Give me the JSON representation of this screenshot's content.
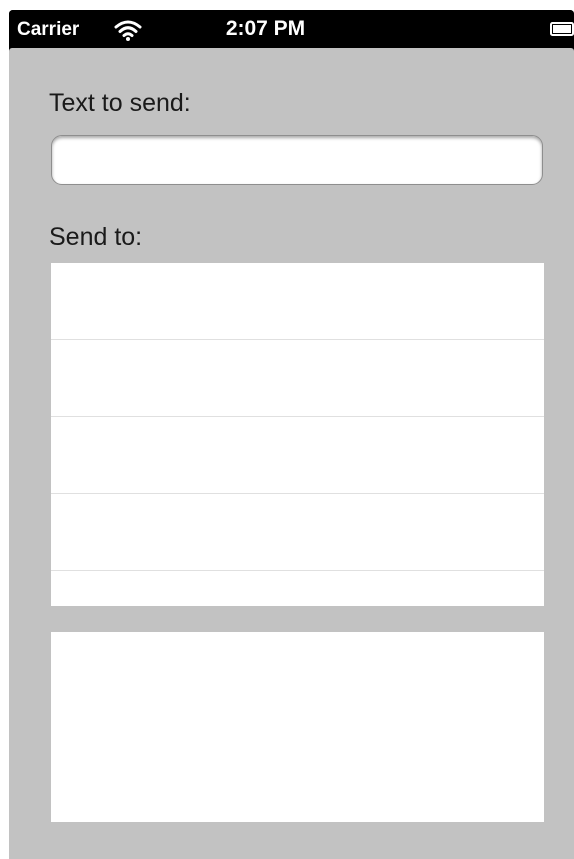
{
  "status_bar": {
    "carrier": "Carrier",
    "time": "2:07 PM",
    "wifi_icon": "wifi-icon",
    "battery_icon": "battery-icon"
  },
  "form": {
    "text_label": "Text to send:",
    "text_value": "",
    "text_placeholder": "",
    "send_to_label": "Send to:"
  },
  "recipients": {
    "rows": [
      "",
      "",
      "",
      "",
      ""
    ]
  },
  "output": {
    "content": ""
  },
  "colors": {
    "screen_background": "#c2c2c2",
    "status_bar": "#000000",
    "panel": "#ffffff",
    "separator": "#e0e0e0"
  }
}
